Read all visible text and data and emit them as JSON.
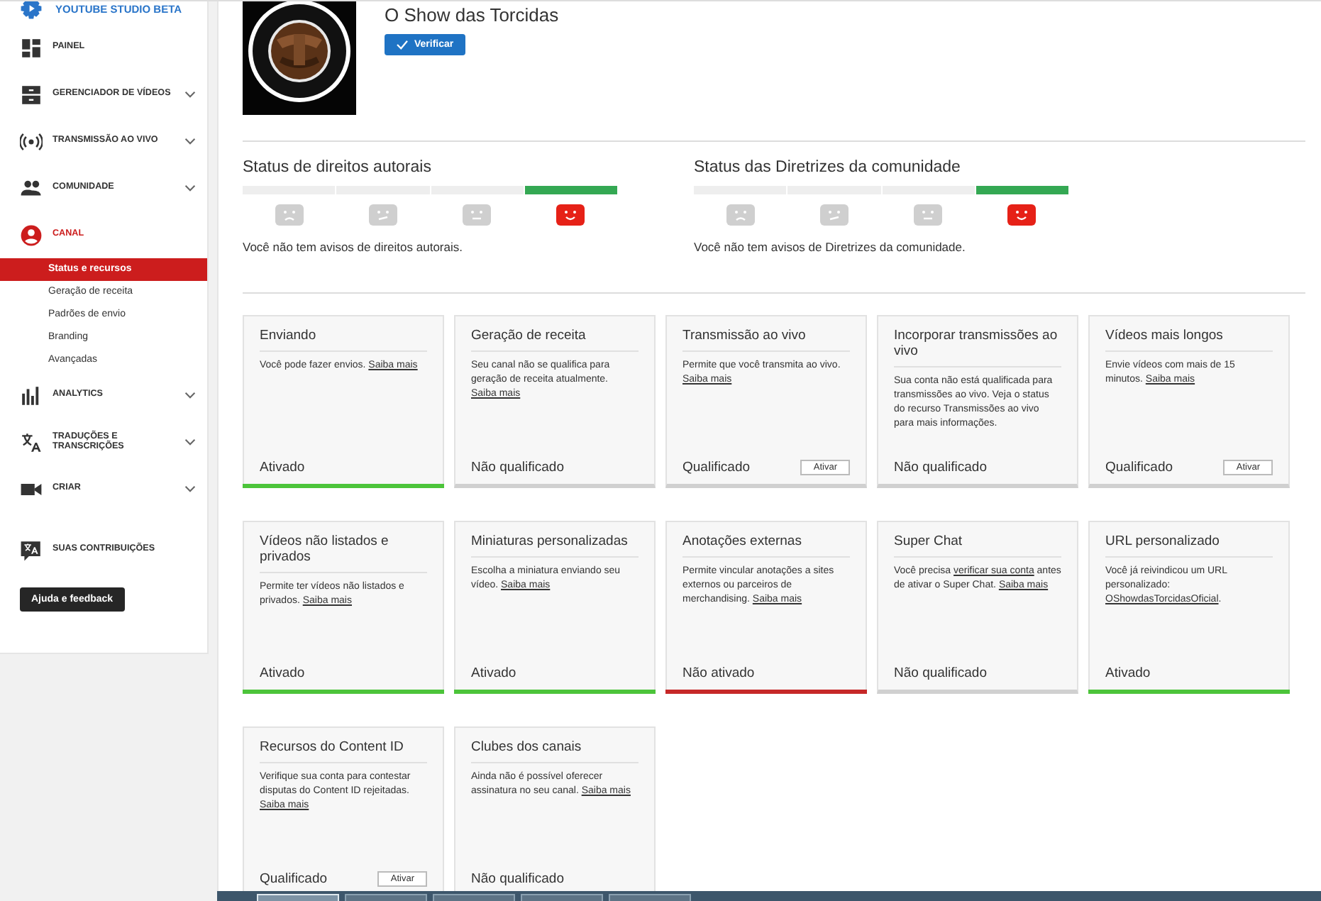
{
  "sidebar": {
    "brand": "YOUTUBE STUDIO BETA",
    "items": [
      {
        "label": "PAINEL",
        "kind": "dashboard",
        "expandable": false,
        "selected": false
      },
      {
        "label": "GERENCIADOR DE VÍDEOS",
        "kind": "manager",
        "expandable": true,
        "selected": false
      },
      {
        "label": "TRANSMISSÃO AO VIVO",
        "kind": "live",
        "expandable": true,
        "selected": false
      },
      {
        "label": "COMUNIDADE",
        "kind": "community",
        "expandable": true,
        "selected": false
      },
      {
        "label": "CANAL",
        "kind": "channel",
        "expandable": false,
        "selected": true,
        "children": [
          {
            "label": "Status e recursos",
            "selected": true
          },
          {
            "label": "Geração de receita",
            "selected": false
          },
          {
            "label": "Padrões de envio",
            "selected": false
          },
          {
            "label": "Branding",
            "selected": false
          },
          {
            "label": "Avançadas",
            "selected": false
          }
        ]
      },
      {
        "label": "ANALYTICS",
        "kind": "analytics",
        "expandable": true,
        "selected": false
      },
      {
        "label": "TRADUÇÕES E TRANSCRIÇÕES",
        "kind": "translate",
        "expandable": true,
        "selected": false
      },
      {
        "label": "CRIAR",
        "kind": "create",
        "expandable": true,
        "selected": false
      }
    ],
    "contributions": "SUAS CONTRIBUIÇÕES",
    "help_button": "Ajuda e feedback"
  },
  "channel": {
    "name": "O Show das Torcidas",
    "verify_button": "Verificar"
  },
  "strikes": [
    {
      "title": "Status de direitos autorais",
      "segments": [
        {
          "kind": "sad",
          "selected": false
        },
        {
          "kind": "wry",
          "selected": false
        },
        {
          "kind": "neutral",
          "selected": false
        },
        {
          "kind": "happy",
          "selected": true
        }
      ],
      "message": "Você não tem avisos de direitos autorais."
    },
    {
      "title": "Status das Diretrizes da comunidade",
      "segments": [
        {
          "kind": "sad",
          "selected": false
        },
        {
          "kind": "wry",
          "selected": false
        },
        {
          "kind": "neutral",
          "selected": false
        },
        {
          "kind": "happy",
          "selected": true
        }
      ],
      "message": "Você não tem avisos de Diretrizes da comunidade."
    }
  ],
  "features": [
    {
      "title": "Enviando",
      "description": [
        {
          "text": "Você pode fazer envios. "
        },
        {
          "link": "Saiba mais"
        }
      ],
      "status": "Ativado",
      "color": "#4cc43a"
    },
    {
      "title": "Geração de receita",
      "description": [
        {
          "text": "Seu canal não se qualifica para geração de receita atualmente. "
        },
        {
          "link": "Saiba mais"
        }
      ],
      "status": "Não qualificado"
    },
    {
      "title": "Transmissão ao vivo",
      "description": [
        {
          "text": "Permite que você transmita ao vivo. "
        },
        {
          "link": "Saiba mais"
        }
      ],
      "status": "Qualificado",
      "button": "Ativar"
    },
    {
      "title": "Incorporar transmissões ao vivo",
      "description": [
        {
          "text": "Sua conta não está qualificada para transmissões ao vivo. Veja o status do recurso Transmissões ao vivo para mais informações."
        }
      ],
      "status": "Não qualificado"
    },
    {
      "title": "Vídeos mais longos",
      "description": [
        {
          "text": "Envie vídeos com mais de 15 minutos. "
        },
        {
          "link": "Saiba mais"
        }
      ],
      "status": "Qualificado",
      "button": "Ativar"
    },
    {
      "title": "Vídeos não listados e privados",
      "description": [
        {
          "text": "Permite ter vídeos não listados e privados. "
        },
        {
          "link": "Saiba mais"
        }
      ],
      "status": "Ativado",
      "color": "#4cc43a"
    },
    {
      "title": "Miniaturas personalizadas",
      "description": [
        {
          "text": "Escolha a miniatura enviando seu vídeo. "
        },
        {
          "link": "Saiba mais"
        }
      ],
      "status": "Ativado",
      "color": "#4cc43a"
    },
    {
      "title": "Anotações externas",
      "description": [
        {
          "text": "Permite vincular anotações a sites externos ou parceiros de merchandising. "
        },
        {
          "link": "Saiba mais"
        }
      ],
      "status": "Não ativado",
      "color": "#c62828"
    },
    {
      "title": "Super Chat",
      "description": [
        {
          "text": "Você precisa "
        },
        {
          "link": "verificar sua conta"
        },
        {
          "text": " antes de ativar o Super Chat. "
        },
        {
          "link": "Saiba mais"
        }
      ],
      "status": "Não qualificado"
    },
    {
      "title": "URL personalizado",
      "description": [
        {
          "text": "Você já reivindicou um URL personalizado: "
        },
        {
          "link": "OShowdasTorcidasOficial"
        },
        {
          "text": "."
        }
      ],
      "status": "Ativado",
      "color": "#4cc43a"
    },
    {
      "title": "Recursos do Content ID",
      "description": [
        {
          "text": "Verifique sua conta para contestar disputas do Content ID rejeitadas. "
        },
        {
          "link": "Saiba mais"
        }
      ],
      "status": "Qualificado",
      "button": "Ativar"
    },
    {
      "title": "Clubes dos canais",
      "description": [
        {
          "text": "Ainda não é possível oferecer assinatura no seu canal. "
        },
        {
          "link": "Saiba mais"
        }
      ],
      "status": "Não qualificado"
    }
  ]
}
